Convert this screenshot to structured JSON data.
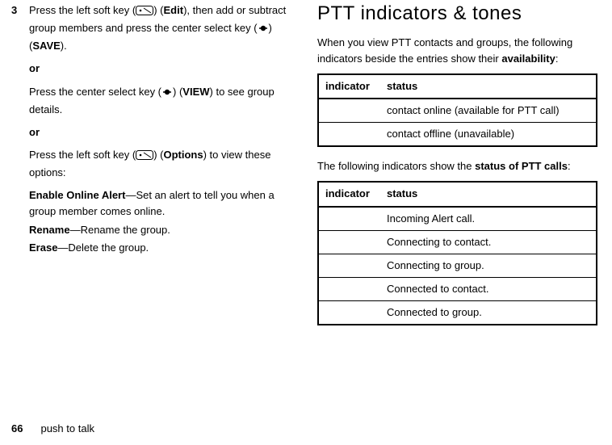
{
  "left": {
    "step_num": "3",
    "p1_a": "Press the left soft key (",
    "p1_b": ") (",
    "edit": "Edit",
    "p1_c": "), then add or subtract group members and press the center select key (",
    "p1_d": ") (",
    "save": "SAVE",
    "p1_e": ").",
    "or": "or",
    "p2_a": "Press the center select key (",
    "p2_b": ") (",
    "view": "VIEW",
    "p2_c": ") to see group details.",
    "p3_a": "Press the left soft key (",
    "p3_b": ") (",
    "options": "Options",
    "p3_c": ") to view these options:",
    "def1_t": "Enable Online Alert",
    "def1_b": "—Set an alert to tell you when a group member comes online.",
    "def2_t": "Rename",
    "def2_b": "—Rename the group.",
    "def3_t": "Erase",
    "def3_b": "—Delete the group."
  },
  "right": {
    "heading": "PTT indicators & tones",
    "intro_a": "When you view PTT contacts and groups, the following indicators beside the entries show their ",
    "intro_bold": "availability",
    "intro_b": ":",
    "table1": {
      "h1": "indicator",
      "h2": "status",
      "rows": [
        {
          "status": "contact online (available for PTT call)"
        },
        {
          "status": "contact offline (unavailable)"
        }
      ]
    },
    "mid_a": "The following indicators show the ",
    "mid_bold": "status of PTT calls",
    "mid_b": ":",
    "table2": {
      "h1": "indicator",
      "h2": "status",
      "rows": [
        {
          "status": "Incoming Alert call."
        },
        {
          "status": "Connecting to contact."
        },
        {
          "status": "Connecting to group."
        },
        {
          "status": "Connected to contact."
        },
        {
          "status": "Connected to group."
        }
      ]
    }
  },
  "footer": {
    "page": "66",
    "section": "push to talk"
  }
}
